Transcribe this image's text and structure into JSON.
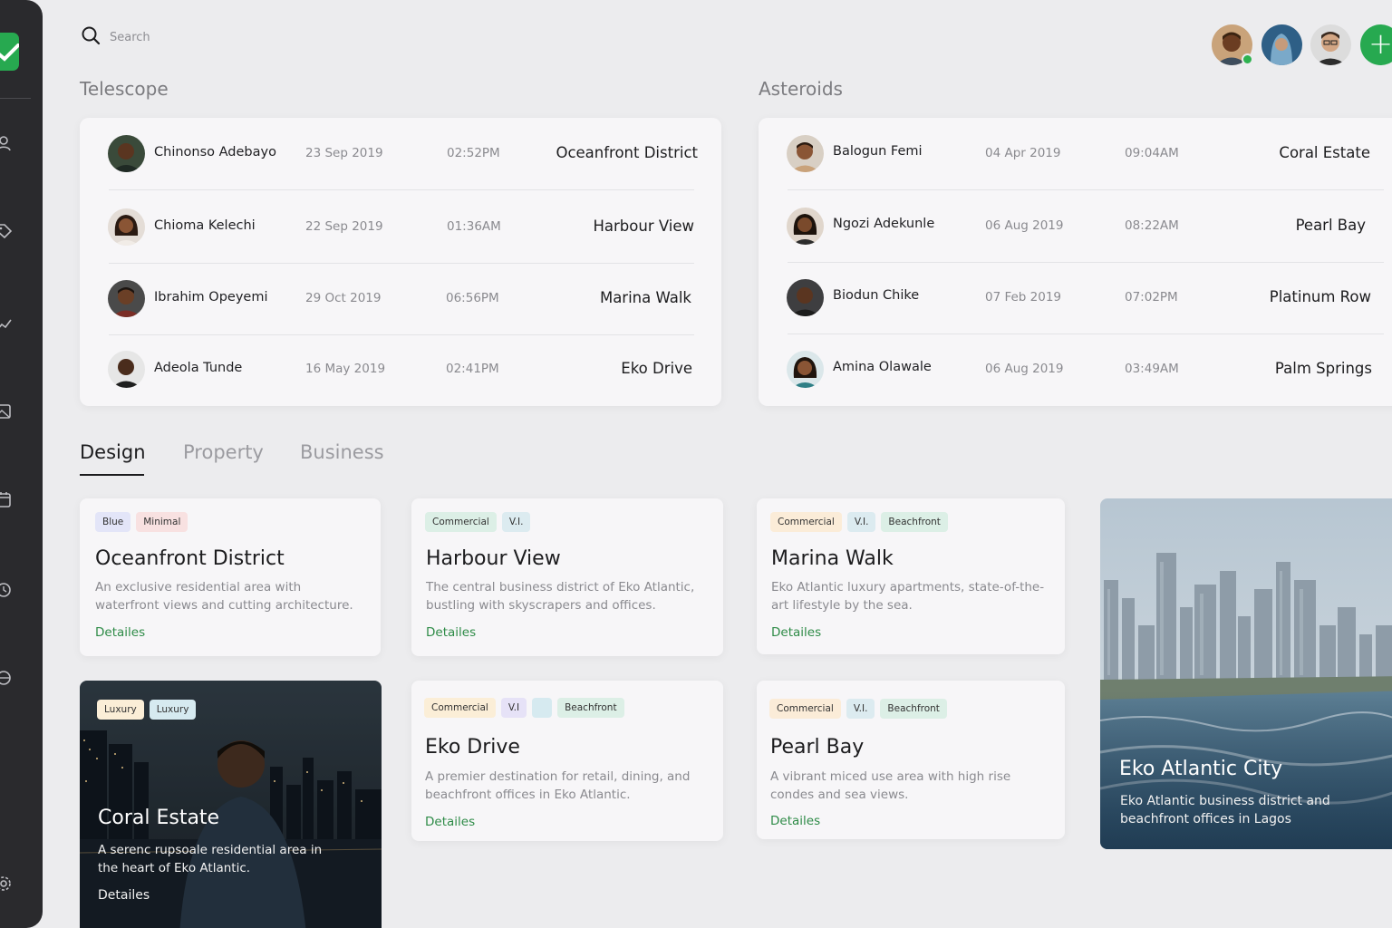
{
  "search": {
    "placeholder": "Search"
  },
  "sections": {
    "telescope": "Telescope",
    "asteroids": "Asteroids"
  },
  "telescope_rows": [
    {
      "name": "Chinonso Adebayo",
      "date": "23 Sep 2019",
      "time": "02:52PM",
      "place": "Oceanfront District"
    },
    {
      "name": "Chioma Kelechi",
      "date": "22 Sep 2019",
      "time": "01:36AM",
      "place": "Harbour View"
    },
    {
      "name": "Ibrahim Opeyemi",
      "date": "29 Oct 2019",
      "time": "06:56PM",
      "place": "Marina Walk"
    },
    {
      "name": "Adeola Tunde",
      "date": "16 May 2019",
      "time": "02:41PM",
      "place": "Eko Drive"
    }
  ],
  "asteroid_rows": [
    {
      "name": "Balogun Femi",
      "date": "04 Apr 2019",
      "time": "09:04AM",
      "place": "Coral Estate"
    },
    {
      "name": "Ngozi Adekunle",
      "date": "06 Aug 2019",
      "time": "08:22AM",
      "place": "Pearl Bay"
    },
    {
      "name": "Biodun Chike",
      "date": "07 Feb 2019",
      "time": "07:02PM",
      "place": "Platinum Row"
    },
    {
      "name": "Amina Olawale",
      "date": "06 Aug 2019",
      "time": "03:49AM",
      "place": "Palm Springs"
    }
  ],
  "tabs": [
    "Design",
    "Property",
    "Business"
  ],
  "cards": {
    "oceanfront": {
      "tags": [
        "Blue",
        "Minimal"
      ],
      "title": "Oceanfront District",
      "desc": "An exclusive residential area with waterfront views and cutting architecture.",
      "link": "Detailes"
    },
    "harbour": {
      "tags": [
        "Commercial",
        "V.I."
      ],
      "title": "Harbour View",
      "desc": "The central business district of Eko Atlantic, bustling with skyscrapers and offices.",
      "link": "Detailes"
    },
    "marina": {
      "tags": [
        "Commercial",
        "V.I.",
        "Beachfront"
      ],
      "title": "Marina Walk",
      "desc": "Eko Atlantic luxury apartments, state-of-the-art lifestyle by the sea.",
      "link": "Detailes"
    },
    "coral": {
      "tags": [
        "Luxury",
        "Luxury"
      ],
      "title": "Coral Estate",
      "desc": "A serenc rupsoale residential area in the heart of Eko Atlantic.",
      "link": "Detailes"
    },
    "eko": {
      "tags": [
        "Commercial",
        "V.I",
        "Beachfront"
      ],
      "title": "Eko Drive",
      "desc": "A premier destination for retail, dining, and beachfront offices in Eko Atlantic.",
      "link": "Detailes"
    },
    "pearl": {
      "tags": [
        "Commercial",
        "V.I.",
        "Beachfront"
      ],
      "title": "Pearl Bay",
      "desc": "A vibrant miced use area with high rise condes and sea views.",
      "link": "Detailes"
    },
    "city": {
      "title": "Eko Atlantic City",
      "desc": "Eko Atlantic business district and beachfront offices in Lagos"
    }
  },
  "colors": {
    "accent": "#27a950",
    "link": "#2e8b47",
    "sidebar": "#2a2a2d",
    "background": "#ececee"
  }
}
